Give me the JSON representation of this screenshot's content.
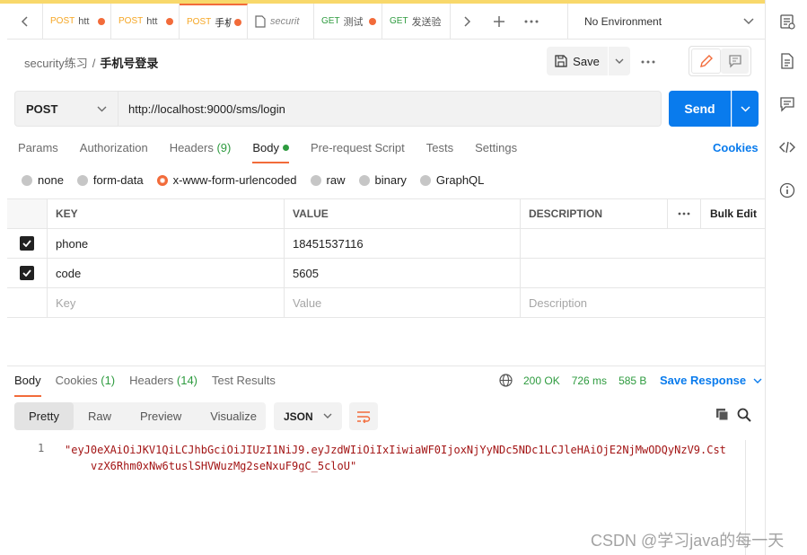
{
  "tabs": [
    {
      "method": "POST",
      "title": "htt",
      "style": "post",
      "dirty": true
    },
    {
      "method": "POST",
      "title": "htt",
      "style": "post",
      "dirty": true
    },
    {
      "method": "POST",
      "title": "手机",
      "style": "post",
      "dirty": true,
      "active": true
    },
    {
      "method": "",
      "title": "securit",
      "style": "doc",
      "dirty": false
    },
    {
      "method": "GET",
      "title": "测试",
      "style": "get",
      "dirty": true
    },
    {
      "method": "GET",
      "title": "发送验",
      "style": "get",
      "dirty": false
    }
  ],
  "environment": "No Environment",
  "breadcrumb": {
    "collection": "security练习",
    "separator": "/",
    "request": "手机号登录"
  },
  "toolbar": {
    "save_label": "Save"
  },
  "request": {
    "method": "POST",
    "url": "http://localhost:9000/sms/login",
    "send_label": "Send"
  },
  "request_tabs": {
    "params": "Params",
    "authorization": "Authorization",
    "headers": "Headers",
    "headers_count": "(9)",
    "body": "Body",
    "pre_request": "Pre-request Script",
    "tests": "Tests",
    "settings": "Settings",
    "cookies": "Cookies"
  },
  "body_types": {
    "none": "none",
    "form_data": "form-data",
    "urlencoded": "x-www-form-urlencoded",
    "raw": "raw",
    "binary": "binary",
    "graphql": "GraphQL"
  },
  "kv_table": {
    "headers": {
      "key": "KEY",
      "value": "VALUE",
      "description": "DESCRIPTION",
      "bulk_edit": "Bulk Edit"
    },
    "rows": [
      {
        "key": "phone",
        "value": "18451537116",
        "description": ""
      },
      {
        "key": "code",
        "value": "5605",
        "description": ""
      }
    ],
    "placeholder": {
      "key": "Key",
      "value": "Value",
      "description": "Description"
    }
  },
  "response_tabs": {
    "body": "Body",
    "cookies": "Cookies",
    "cookies_count": "(1)",
    "headers": "Headers",
    "headers_count": "(14)",
    "test_results": "Test Results"
  },
  "status": {
    "code": "200 OK",
    "time": "726 ms",
    "size": "585 B",
    "save_response": "Save Response"
  },
  "view_modes": {
    "pretty": "Pretty",
    "raw": "Raw",
    "preview": "Preview",
    "visualize": "Visualize"
  },
  "format": "JSON",
  "response_body": {
    "line_number": "1",
    "text": "\"eyJ0eXAiOiJKV1QiLCJhbGciOiJIUzI1NiJ9.eyJzdWIiOiIxIiwiaWF0IjoxNjYyNDc5NDc1LCJleHAiOjE2NjMwODQyNzV9.CstvzX6Rhm0xNw6tuslSHVWuzMg2seNxuF9gC_5cloU\""
  },
  "watermark": "CSDN @学习java的每一天",
  "colors": {
    "accent": "#f26b3a",
    "send": "#097bed",
    "success": "#2e9b3f"
  }
}
